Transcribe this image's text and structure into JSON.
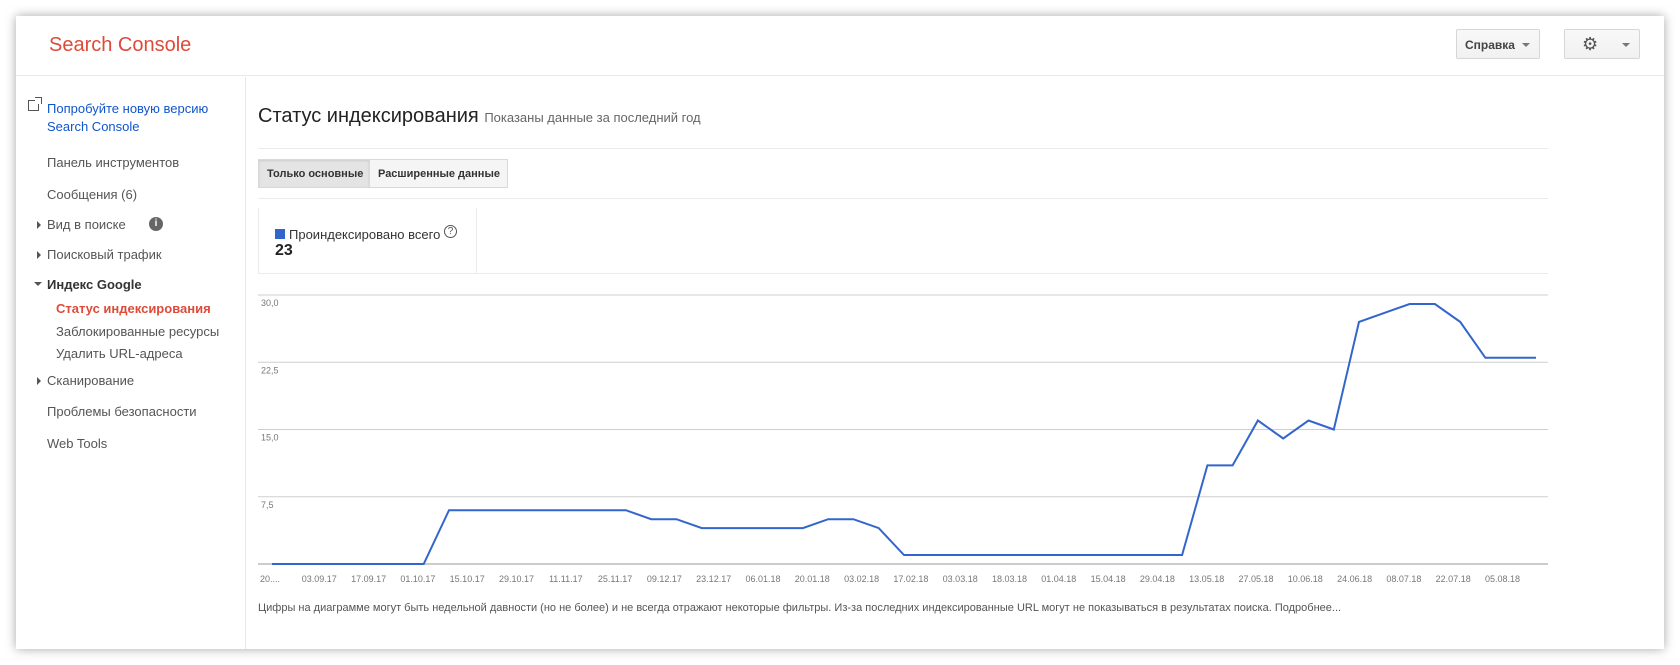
{
  "header": {
    "app_title": "Search Console",
    "help_label": "Справка",
    "settings_icon": "gear-icon"
  },
  "sidebar": {
    "try_new": {
      "line1": "Попробуйте новую версию",
      "line2": "Search Console",
      "icon": "external-link-icon"
    },
    "dashboard": "Панель инструментов",
    "messages": "Сообщения (6)",
    "search_appearance": "Вид в поиске",
    "search_traffic": "Поисковый трафик",
    "google_index": "Индекс Google",
    "index_status": "Статус индексирования",
    "blocked_resources": "Заблокированные ресурсы",
    "remove_urls": "Удалить URL-адреса",
    "crawl": "Сканирование",
    "security_issues": "Проблемы безопасности",
    "web_tools": "Web Tools"
  },
  "main": {
    "title": "Статус индексирования",
    "subtitle": "Показаны данные за последний год",
    "tabs": [
      {
        "label": "Только основные",
        "selected": true
      },
      {
        "label": "Расширенные данные",
        "selected": false
      }
    ],
    "legend": {
      "label": "Проиндексировано всего",
      "value": "23",
      "color": "#3366cc"
    },
    "footnote": "Цифры на диаграмме могут быть недельной давности (но не более) и не всегда отражают некоторые фильтры. Из-за последних индексированные URL могут не показываться в результатах поиска.",
    "more_link": "Подробнее..."
  },
  "chart_data": {
    "type": "line",
    "series": [
      {
        "name": "Проиндексировано всего",
        "color": "#3366cc",
        "values": [
          0,
          0,
          0,
          0,
          0,
          0,
          0,
          6,
          6,
          6,
          6,
          6,
          6,
          6,
          6,
          5,
          5,
          4,
          4,
          4,
          4,
          4,
          5,
          5,
          4,
          1,
          1,
          1,
          1,
          1,
          1,
          1,
          1,
          1,
          1,
          1,
          1,
          11,
          11,
          16,
          14,
          16,
          15,
          27,
          28,
          29,
          29,
          27,
          23,
          23,
          23
        ]
      }
    ],
    "x_tick_labels": [
      "20....",
      "03.09.17",
      "17.09.17",
      "01.10.17",
      "15.10.17",
      "29.10.17",
      "11.11.17",
      "25.11.17",
      "09.12.17",
      "23.12.17",
      "06.01.18",
      "20.01.18",
      "03.02.18",
      "17.02.18",
      "03.03.18",
      "18.03.18",
      "01.04.18",
      "15.04.18",
      "29.04.18",
      "13.05.18",
      "27.05.18",
      "10.06.18",
      "24.06.18",
      "08.07.18",
      "22.07.18",
      "05.08.18"
    ],
    "y_tick_labels": [
      "30,0",
      "22,5",
      "15,0",
      "7,5"
    ],
    "y_ticks": [
      30,
      22.5,
      15,
      7.5
    ],
    "ylim": [
      0,
      30
    ],
    "grid": true
  }
}
